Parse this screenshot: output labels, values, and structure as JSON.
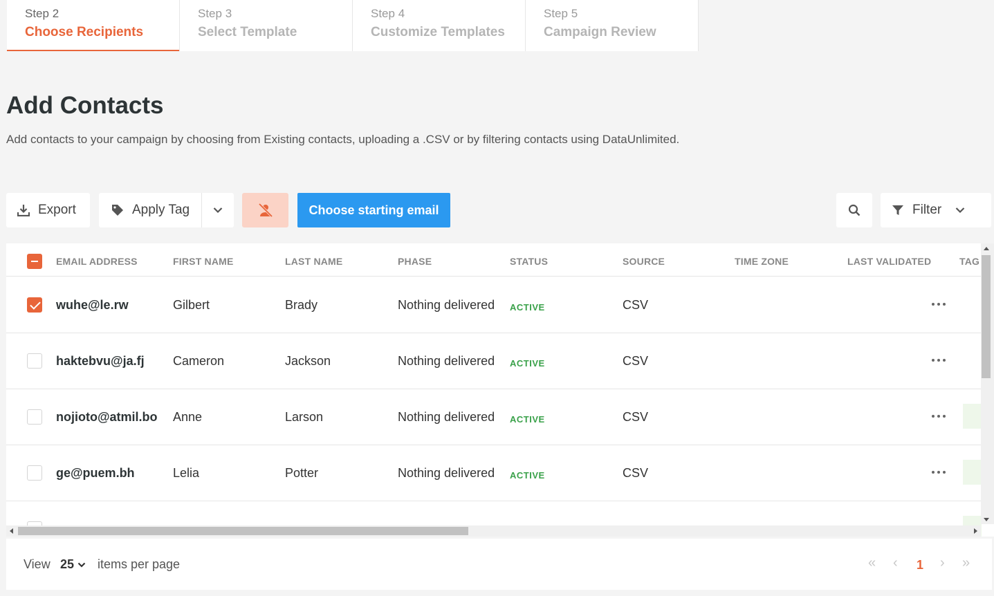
{
  "steps": [
    {
      "num": "Step 2",
      "name": "Choose Recipients"
    },
    {
      "num": "Step 3",
      "name": "Select Template"
    },
    {
      "num": "Step 4",
      "name": "Customize Templates"
    },
    {
      "num": "Step 5",
      "name": "Campaign Review"
    }
  ],
  "page": {
    "title": "Add Contacts",
    "description": "Add contacts to your campaign by choosing from Existing contacts, uploading a .CSV or by filtering contacts using DataUnlimited."
  },
  "toolbar": {
    "export_label": "Export",
    "apply_tag_label": "Apply Tag",
    "choose_email_label": "Choose starting email",
    "filter_label": "Filter"
  },
  "table": {
    "columns": [
      "EMAIL ADDRESS",
      "FIRST NAME",
      "LAST NAME",
      "PHASE",
      "STATUS",
      "SOURCE",
      "TIME ZONE",
      "LAST VALIDATED",
      "TAG"
    ],
    "rows": [
      {
        "email": "wuhe@le.rw",
        "first": "Gilbert",
        "last": "Brady",
        "phase": "Nothing delivered",
        "status": "ACTIVE",
        "source": "CSV",
        "checked": true
      },
      {
        "email": "haktebvu@ja.fj",
        "first": "Cameron",
        "last": "Jackson",
        "phase": "Nothing delivered",
        "status": "ACTIVE",
        "source": "CSV",
        "checked": false
      },
      {
        "email": "nojioto@atmil.bo",
        "first": "Anne",
        "last": "Larson",
        "phase": "Nothing delivered",
        "status": "ACTIVE",
        "source": "CSV",
        "checked": false
      },
      {
        "email": "ge@puem.bh",
        "first": "Lelia",
        "last": "Potter",
        "phase": "Nothing delivered",
        "status": "ACTIVE",
        "source": "CSV",
        "checked": false
      }
    ]
  },
  "pagination": {
    "view_label": "View",
    "per_page": "25",
    "items_label": "items per page",
    "current_page": "1",
    "first_icon": "«",
    "prev_icon": "‹",
    "next_icon": "›",
    "last_icon": "»"
  },
  "colors": {
    "accent": "#e8653a",
    "primary_button": "#2b99f0",
    "status_active": "#3aa14a"
  }
}
